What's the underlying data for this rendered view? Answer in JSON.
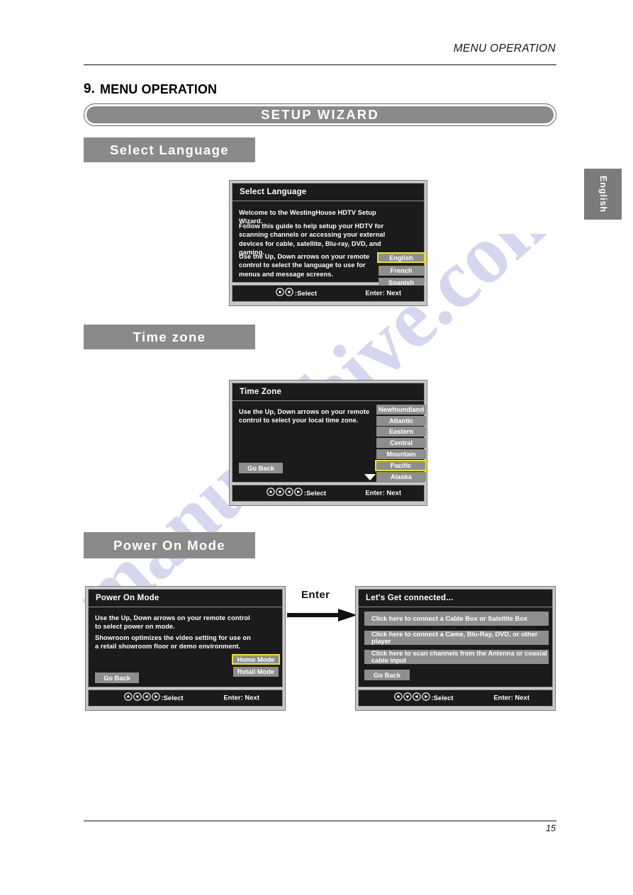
{
  "header": {
    "running_title": "MENU OPERATION"
  },
  "side_tab": {
    "label": "English"
  },
  "section": {
    "number": "9.",
    "title": "MENU OPERATION",
    "wizard_banner": "SETUP  WIZARD"
  },
  "bars": {
    "select_language": "Select Language",
    "time_zone": "Time zone",
    "power_on_mode": "Power On Mode"
  },
  "footer": {
    "page_number": "15"
  },
  "flow": {
    "enter_label": "Enter"
  },
  "panels": {
    "select_language": {
      "title": "Select Language",
      "paragraphs": [
        "Welcome to the WestingHouse HDTV Setup Wizard.",
        "Follow this guide to help setup your HDTV for scanning channels or accessing your external devices for cable, satellite, Blu-ray, DVD, and gaming.",
        "Use the Up, Down arrows on your remote control  to select the language to use for menus and message screens."
      ],
      "options": [
        {
          "label": "English",
          "selected": true
        },
        {
          "label": "French",
          "selected": false
        },
        {
          "label": "Spanish",
          "selected": false
        }
      ],
      "footer_select": ":Select",
      "footer_enter": "Enter: Next",
      "footer_keys": [
        "up-arrow-key-icon",
        "down-arrow-key-icon"
      ]
    },
    "time_zone": {
      "title": "Time Zone",
      "paragraphs": [
        "Use the Up, Down arrows on your remote control to select your local time zone."
      ],
      "options": [
        {
          "label": "Newfoundland",
          "selected": false
        },
        {
          "label": "Atlantic",
          "selected": false
        },
        {
          "label": "Eastern",
          "selected": false
        },
        {
          "label": "Central",
          "selected": false
        },
        {
          "label": "Mountain",
          "selected": false
        },
        {
          "label": "Pacific",
          "selected": true
        },
        {
          "label": "Alaska",
          "selected": false
        }
      ],
      "go_back": "Go Back",
      "footer_select": ":Select",
      "footer_enter": "Enter: Next",
      "footer_keys": [
        "up-arrow-key-icon",
        "down-arrow-key-icon",
        "left-arrow-key-icon",
        "right-arrow-key-icon"
      ]
    },
    "power_on_mode": {
      "title": "Power On Mode",
      "paragraphs": [
        "Use the Up, Down arrows on your remote control to select power on mode.",
        "Showroom optimizes the video setting for use on a retail showroom floor or demo environment."
      ],
      "options": [
        {
          "label": "Home Mode",
          "selected": true
        },
        {
          "label": "Retail Mode",
          "selected": false
        }
      ],
      "go_back": "Go Back",
      "footer_select": ":Select",
      "footer_enter": "Enter: Next",
      "footer_keys": [
        "up-arrow-key-icon",
        "down-arrow-key-icon",
        "left-arrow-key-icon",
        "right-arrow-key-icon"
      ]
    },
    "lets_get_connected": {
      "title": "Let's Get connected...",
      "options": [
        {
          "label": "Click here to connect a Cable Box or Satellite Box",
          "selected": false
        },
        {
          "label": "Click here to connect a Came, Blu-Ray, DVD, or other player",
          "selected": false
        },
        {
          "label": "Click here to scan channels from the Antenna or coaxial cable input",
          "selected": false
        }
      ],
      "go_back": "Go Back",
      "footer_select": ":Select",
      "footer_enter": "Enter: Next",
      "footer_keys": [
        "up-arrow-key-icon",
        "down-arrow-key-icon",
        "left-arrow-key-icon",
        "right-arrow-key-icon"
      ]
    }
  },
  "colors": {
    "bar_gray": "#8a8a8a",
    "osd_dark": "#1b1b1b",
    "option_gray": "#8e8e8e",
    "selection_yellow": "#f2e21a"
  }
}
